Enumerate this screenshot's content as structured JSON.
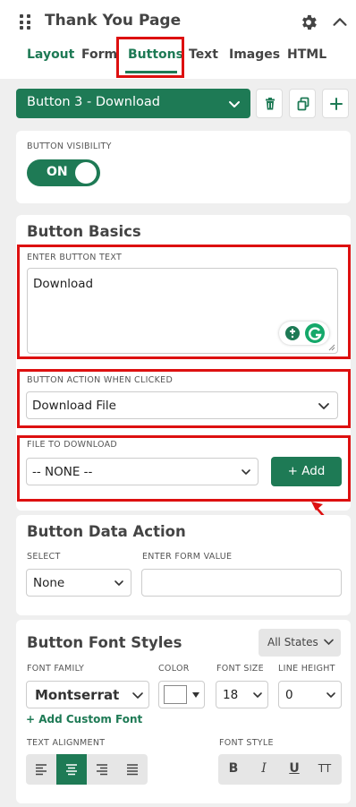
{
  "header": {
    "title": "Thank You Page",
    "tabs": [
      "Layout",
      "Form",
      "Buttons",
      "Text",
      "Images",
      "HTML"
    ],
    "active_tab": "Buttons"
  },
  "button_selector": {
    "selected": "Button 3 - Download"
  },
  "visibility": {
    "label": "BUTTON VISIBILITY",
    "toggle_text": "ON"
  },
  "basics": {
    "title": "Button Basics",
    "text_label": "ENTER BUTTON TEXT",
    "text_value": "Download",
    "action_label": "BUTTON ACTION WHEN CLICKED",
    "action_value": "Download File",
    "file_label": "FILE TO DOWNLOAD",
    "file_value": "-- NONE --",
    "add_button": "+ Add"
  },
  "data_action": {
    "title": "Button Data Action",
    "select_label": "SELECT",
    "select_value": "None",
    "form_value_label": "ENTER FORM VALUE",
    "form_value": ""
  },
  "font_styles": {
    "title": "Button Font Styles",
    "states_button": "All States",
    "family_label": "FONT FAMILY",
    "family_value": "Montserrat",
    "color_label": "COLOR",
    "size_label": "FONT SIZE",
    "size_value": "18",
    "line_height_label": "LINE HEIGHT",
    "line_height_value": "0",
    "add_custom_font": "+ Add Custom Font",
    "alignment_label": "TEXT ALIGNMENT",
    "font_style_label": "FONT STYLE",
    "style_buttons": [
      "B",
      "I",
      "U",
      "TT"
    ]
  },
  "colors": {
    "accent": "#1e7a55",
    "highlight": "#dd1010"
  }
}
